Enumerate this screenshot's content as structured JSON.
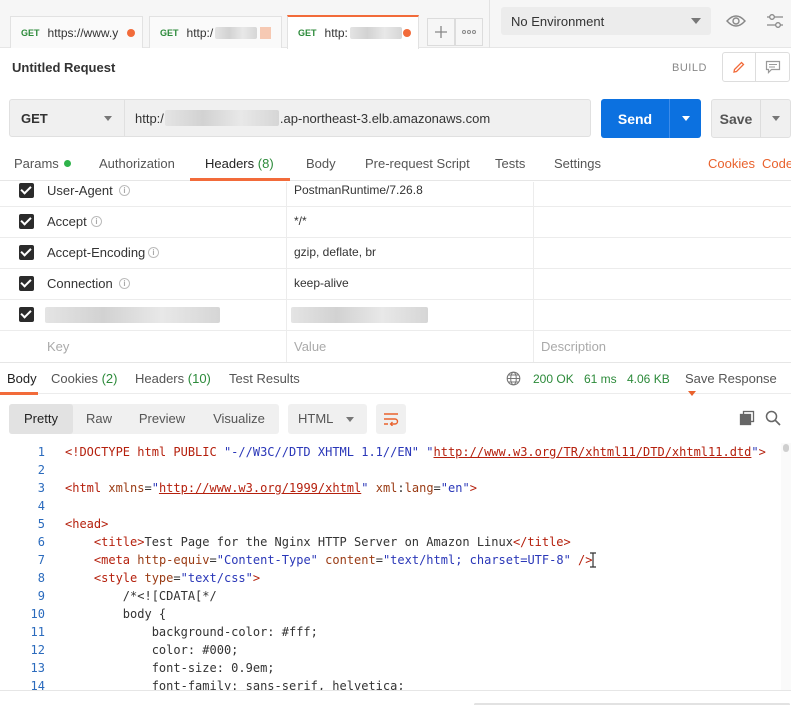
{
  "tabs": [
    {
      "method": "GET",
      "url": "https://www.y",
      "unsaved": true,
      "active": false
    },
    {
      "method": "GET",
      "url": "http:/",
      "unsaved": false,
      "active": false
    },
    {
      "method": "GET",
      "url": "http:",
      "unsaved": true,
      "active": true
    }
  ],
  "environment": {
    "selected": "No Environment"
  },
  "request": {
    "title": "Untitled Request",
    "build_label": "BUILD",
    "method": "GET",
    "url_prefix": "http:/",
    "url_suffix": ".ap-northeast-3.elb.amazonaws.com",
    "send_label": "Send",
    "save_label": "Save"
  },
  "request_tabs": {
    "params": "Params",
    "authorization": "Authorization",
    "headers": "Headers",
    "headers_count": "(8)",
    "body": "Body",
    "prerequest": "Pre-request Script",
    "tests": "Tests",
    "settings": "Settings",
    "cookies": "Cookies",
    "code": "Code"
  },
  "headers": [
    {
      "key": "User-Agent",
      "value": "PostmanRuntime/7.26.8"
    },
    {
      "key": "Accept",
      "value": "*/*"
    },
    {
      "key": "Accept-Encoding",
      "value": "gzip, deflate, br"
    },
    {
      "key": "Connection",
      "value": "keep-alive"
    }
  ],
  "headers_placeholders": {
    "key": "Key",
    "value": "Value",
    "description": "Description"
  },
  "response": {
    "tabs": {
      "body": "Body",
      "cookies": "Cookies",
      "cookies_count": "(2)",
      "headers": "Headers",
      "headers_count": "(10)",
      "tests": "Test Results"
    },
    "status": "200 OK",
    "time": "61 ms",
    "size": "4.06 KB",
    "save_label": "Save Response",
    "views": [
      "Pretty",
      "Raw",
      "Preview",
      "Visualize"
    ],
    "active_view": "Pretty",
    "format": "HTML"
  },
  "code_lines": [
    {
      "n": "1",
      "parts": [
        [
          "tg",
          "<!DOCTYPE html PUBLIC "
        ],
        [
          "st",
          "\"-//W3C//DTD XHTML 1.1//EN\""
        ],
        [
          "kw",
          " "
        ],
        [
          "st",
          "\""
        ],
        [
          "lk",
          "http://www.w3.org/TR/xhtml11/DTD/xhtml11.dtd"
        ],
        [
          "st",
          "\""
        ],
        [
          "tg",
          ">"
        ]
      ]
    },
    {
      "n": "2",
      "parts": []
    },
    {
      "n": "3",
      "parts": [
        [
          "tg",
          "<html "
        ],
        [
          "at",
          "xmlns"
        ],
        [
          "kw",
          "="
        ],
        [
          "st",
          "\""
        ],
        [
          "lk",
          "http://www.w3.org/1999/xhtml"
        ],
        [
          "st",
          "\""
        ],
        [
          "kw",
          " "
        ],
        [
          "at",
          "xml"
        ],
        [
          "kw",
          ":"
        ],
        [
          "at",
          "lang"
        ],
        [
          "kw",
          "="
        ],
        [
          "st",
          "\"en\""
        ],
        [
          "tg",
          ">"
        ]
      ]
    },
    {
      "n": "4",
      "parts": []
    },
    {
      "n": "5",
      "parts": [
        [
          "tg",
          "<head>"
        ]
      ]
    },
    {
      "n": "6",
      "parts": [
        [
          "kw",
          "    "
        ],
        [
          "tg",
          "<title>"
        ],
        [
          "kw",
          "Test Page for the Nginx HTTP Server on Amazon Linux"
        ],
        [
          "tg",
          "</title>"
        ]
      ]
    },
    {
      "n": "7",
      "parts": [
        [
          "kw",
          "    "
        ],
        [
          "tg",
          "<meta "
        ],
        [
          "at",
          "http-equiv"
        ],
        [
          "kw",
          "="
        ],
        [
          "st",
          "\"Content-Type\""
        ],
        [
          "kw",
          " "
        ],
        [
          "at",
          "content"
        ],
        [
          "kw",
          "="
        ],
        [
          "st",
          "\"text/html; charset=UTF-8\""
        ],
        [
          "kw",
          " "
        ],
        [
          "tg",
          "/>"
        ]
      ]
    },
    {
      "n": "8",
      "parts": [
        [
          "kw",
          "    "
        ],
        [
          "tg",
          "<style "
        ],
        [
          "at",
          "type"
        ],
        [
          "kw",
          "="
        ],
        [
          "st",
          "\"text/css\""
        ],
        [
          "tg",
          ">"
        ]
      ]
    },
    {
      "n": "9",
      "parts": [
        [
          "kw",
          "        /*<![CDATA[*/"
        ]
      ]
    },
    {
      "n": "10",
      "parts": [
        [
          "kw",
          "        body {"
        ]
      ]
    },
    {
      "n": "11",
      "parts": [
        [
          "kw",
          "            background-color: #fff;"
        ]
      ]
    },
    {
      "n": "12",
      "parts": [
        [
          "kw",
          "            color: #000;"
        ]
      ]
    },
    {
      "n": "13",
      "parts": [
        [
          "kw",
          "            font-size: 0.9em;"
        ]
      ]
    },
    {
      "n": "14",
      "parts": [
        [
          "kw",
          "            font-family: sans-serif, helvetica;"
        ]
      ]
    }
  ],
  "colors": {
    "accent": "#f26b3a",
    "send": "#0c71e0",
    "success": "#2c8a3a"
  },
  "icons": [
    "eye-icon",
    "sliders-icon",
    "pencil-icon",
    "comment-icon",
    "copy-icon",
    "search-icon",
    "wrap-icon",
    "globe-icon",
    "info-icon"
  ]
}
